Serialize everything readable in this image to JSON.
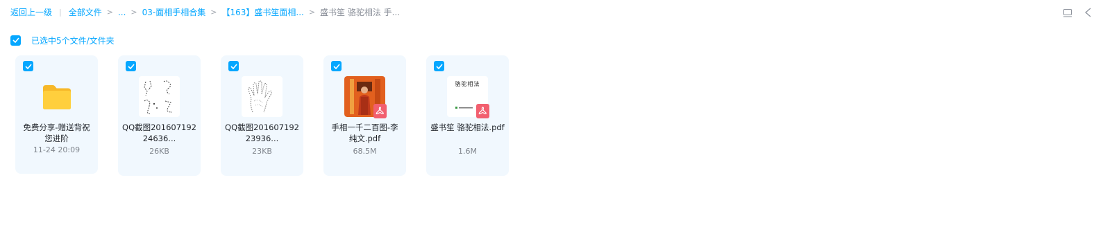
{
  "breadcrumb": {
    "back": "返回上一级",
    "pipe": "|",
    "sep": ">",
    "items": [
      "全部文件",
      "...",
      "03-面相手相合集",
      "【163】盛书笙面相...",
      "盛书笙 骆驼相法 手..."
    ]
  },
  "selection": {
    "text": "已选中5个文件/文件夹",
    "checked": true
  },
  "files": [
    {
      "name": "免费分享-赠送背祝您进阶",
      "meta": "11-24 20:09",
      "type": "folder",
      "icon": "folder-icon"
    },
    {
      "name": "QQ截图20160719224636...",
      "meta": "26KB",
      "type": "image",
      "icon": "image-thumbnail"
    },
    {
      "name": "QQ截图20160719223936...",
      "meta": "23KB",
      "type": "image",
      "icon": "image-thumbnail"
    },
    {
      "name": "手相一千二百图-李纯文.pdf",
      "meta": "68.5M",
      "type": "pdf",
      "icon": "pdf-icon"
    },
    {
      "name": "盛书笙 骆驼相法.pdf",
      "meta": "1.6M",
      "type": "pdf",
      "icon": "pdf-icon"
    }
  ],
  "thumb_texts": {
    "book_title": "骆驼相法"
  },
  "colors": {
    "accent": "#06a7ff",
    "card_bg": "#f1f8fe",
    "folder": "#ffc933",
    "pdf": "#f25f6f"
  }
}
